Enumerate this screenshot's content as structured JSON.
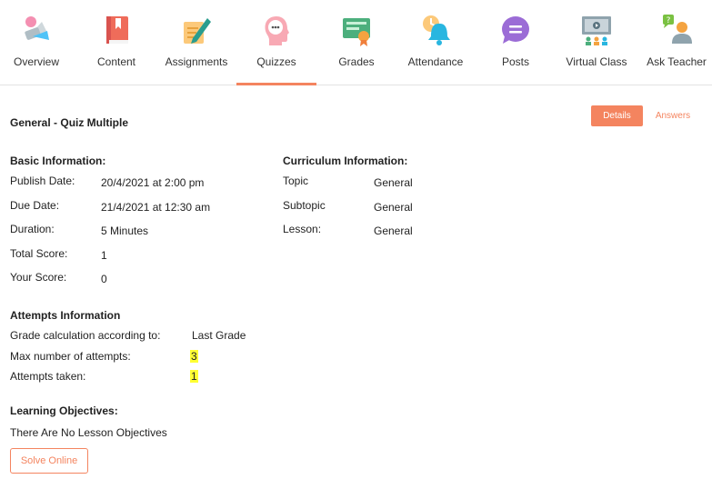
{
  "nav": {
    "items": [
      {
        "label": "Overview"
      },
      {
        "label": "Content"
      },
      {
        "label": "Assignments"
      },
      {
        "label": "Quizzes"
      },
      {
        "label": "Grades"
      },
      {
        "label": "Attendance"
      },
      {
        "label": "Posts"
      },
      {
        "label": "Virtual Class"
      },
      {
        "label": "Ask Teacher"
      }
    ],
    "active": "Quizzes"
  },
  "quiz": {
    "title": "General - Quiz Multiple",
    "details_label": "Details",
    "answers_label": "Answers"
  },
  "basic": {
    "heading": "Basic Information:",
    "publish_label": "Publish Date:",
    "publish_value": "20/4/2021 at 2:00 pm",
    "due_label": "Due Date:",
    "due_value": "21/4/2021 at 12:30 am",
    "duration_label": "Duration:",
    "duration_value": "5 Minutes",
    "total_label": "Total Score:",
    "total_value": "1",
    "your_label": "Your Score:",
    "your_value": "0"
  },
  "curriculum": {
    "heading": "Curriculum Information:",
    "topic_label": "Topic",
    "topic_value": "General",
    "subtopic_label": "Subtopic",
    "subtopic_value": "General",
    "lesson_label": "Lesson:",
    "lesson_value": "General"
  },
  "attempts": {
    "heading": "Attempts Information",
    "grade_label": "Grade calculation according to:",
    "grade_value": "Last Grade",
    "max_label": "Max number of attempts:",
    "max_value": "3",
    "taken_label": "Attempts taken:",
    "taken_value": "1"
  },
  "objectives": {
    "heading": "Learning Objectives:",
    "text": "There Are No Lesson Objectives"
  },
  "solve_label": "Solve Online",
  "colors": {
    "accent": "#f4845f",
    "highlight": "#ffff33"
  }
}
